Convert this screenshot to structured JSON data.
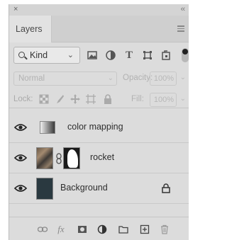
{
  "window": {
    "close_glyph": "×",
    "collapse_glyph": "‹‹"
  },
  "panel": {
    "tab_label": "Layers",
    "menu_icon": "hamburger-menu-icon"
  },
  "filter": {
    "kind_label": "Kind",
    "icons": [
      "image-filter-icon",
      "adjustment-filter-icon",
      "type-filter-icon",
      "shape-filter-icon",
      "smart-object-filter-icon"
    ],
    "type_glyph": "T"
  },
  "blend": {
    "mode": "Normal",
    "opacity_label": "Opacity:",
    "opacity_value": "100%"
  },
  "lock": {
    "label": "Lock:",
    "fill_label": "Fill:",
    "fill_value": "100%"
  },
  "layers": [
    {
      "name": "color mapping",
      "visible": true,
      "thumbnail": "gradient"
    },
    {
      "name": "rocket",
      "visible": true,
      "thumbnail": "photo-with-mask"
    },
    {
      "name": "Background",
      "visible": true,
      "thumbnail": "solid",
      "locked": true
    }
  ],
  "bottom_bar": {
    "fx_label": "fx",
    "icons": [
      "link-layers-icon",
      "fx-icon",
      "add-mask-icon",
      "adjustment-layer-icon",
      "group-folder-icon",
      "new-layer-icon",
      "trash-icon"
    ]
  },
  "colors": {
    "panel_bg": "#dcdcdc",
    "background_layer_fill": "#2a3940"
  }
}
